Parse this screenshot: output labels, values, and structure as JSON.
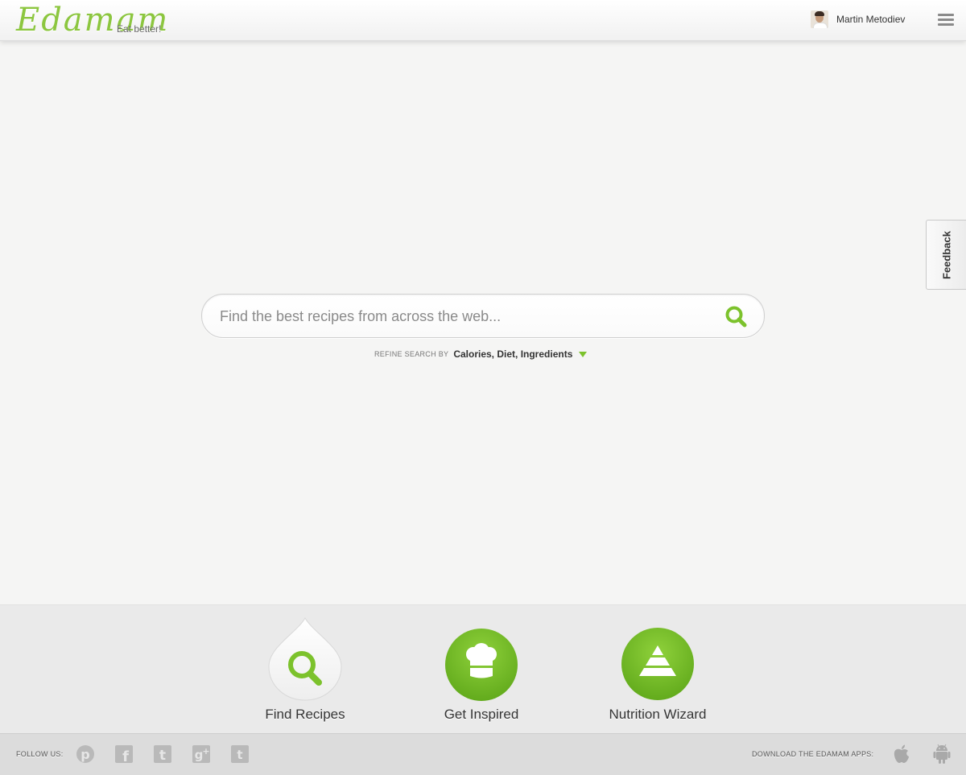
{
  "header": {
    "logo": "Edamam",
    "tagline": "Eat better!",
    "user_name": "Martin Metodiev"
  },
  "search": {
    "placeholder": "Find the best recipes from across the web...",
    "refine_label": "REFINE SEARCH BY",
    "refine_value": "Calories, Diet, Ingredients"
  },
  "feedback": {
    "label": "Feedback"
  },
  "features": [
    {
      "label": "Find Recipes",
      "icon": "search-icon"
    },
    {
      "label": "Get Inspired",
      "icon": "chef-hat-icon"
    },
    {
      "label": "Nutrition Wizard",
      "icon": "pyramid-icon"
    }
  ],
  "footer": {
    "follow_label": "FOLLOW US:",
    "social": [
      "pinterest-icon",
      "facebook-icon",
      "twitter-icon",
      "google-plus-icon",
      "tumblr-icon"
    ],
    "download_label": "DOWNLOAD THE EDAMAM APPS:",
    "apps": [
      "apple-icon",
      "android-icon"
    ]
  },
  "colors": {
    "brand_green": "#7cc22c",
    "logo_green": "#8cc63f",
    "background": "#f5f5f4"
  }
}
